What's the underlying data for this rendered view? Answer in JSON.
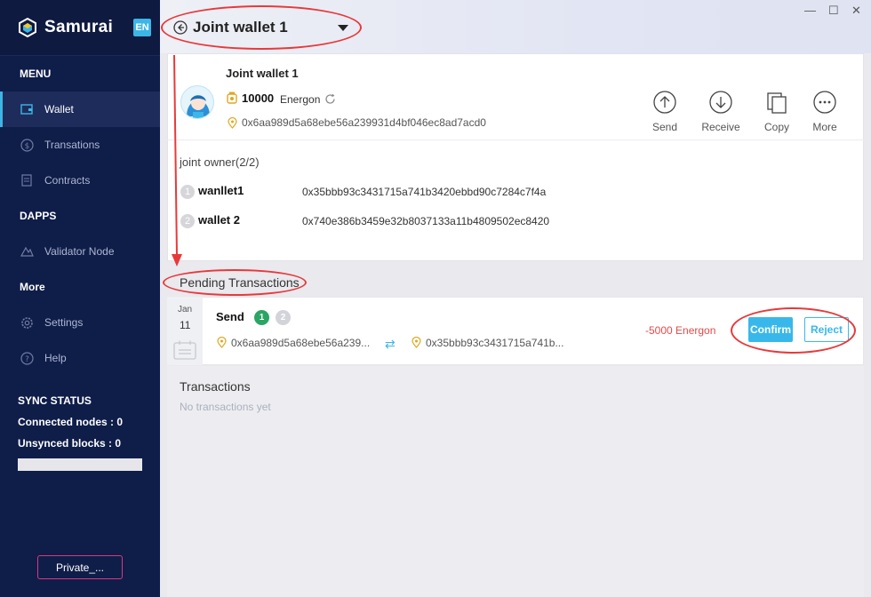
{
  "app": {
    "brand": "Samurai",
    "lang": "EN"
  },
  "sidebar": {
    "menu_title": "MENU",
    "items": [
      {
        "label": "Wallet",
        "icon": "wallet-icon",
        "active": true
      },
      {
        "label": "Transations",
        "icon": "dollar-icon"
      },
      {
        "label": "Contracts",
        "icon": "contract-icon"
      }
    ],
    "dapps_title": "DAPPS",
    "dapps": [
      {
        "label": "Validator Node",
        "icon": "validator-icon"
      }
    ],
    "more_title": "More",
    "more": [
      {
        "label": "Settings",
        "icon": "gear-icon"
      },
      {
        "label": "Help",
        "icon": "help-icon"
      }
    ],
    "sync": {
      "title": "SYNC STATUS",
      "connected": "Connected nodes : 0",
      "unsynced": "Unsynced blocks : 0"
    },
    "private_button": "Private_..."
  },
  "header": {
    "wallet_select": "Joint wallet 1"
  },
  "wallet": {
    "name": "Joint wallet 1",
    "balance": "10000",
    "unit": "Energon",
    "address": "0x6aa989d5a68ebe56a239931d4bf046ec8ad7acd0",
    "actions": [
      "Send",
      "Receive",
      "Copy",
      "More"
    ],
    "owners_title": "joint owner(2/2)",
    "owners": [
      {
        "num": "1",
        "name": "wanllet1",
        "address": "0x35bbb93c3431715a741b3420ebbd90c7284c7f4a"
      },
      {
        "num": "2",
        "name": "wallet 2",
        "address": "0x740e386b3459e32b8037133a11b4809502ec8420"
      }
    ]
  },
  "pending": {
    "title": "Pending Transactions",
    "item": {
      "month": "Jan",
      "day": "11",
      "type": "Send",
      "sig1": "1",
      "sig2": "2",
      "from": "0x6aa989d5a68ebe56a239...",
      "to": "0x35bbb93c3431715a741b...",
      "amount": "-5000 Energon",
      "confirm": "Confirm",
      "reject": "Reject"
    }
  },
  "transactions": {
    "title": "Transactions",
    "empty": "No transactions yet"
  },
  "colors": {
    "sidebar": "#0f1d49",
    "accent": "#38b8ea",
    "negative": "#e24a4a",
    "annotation": "#e8393a",
    "signed": "#2aa563"
  }
}
